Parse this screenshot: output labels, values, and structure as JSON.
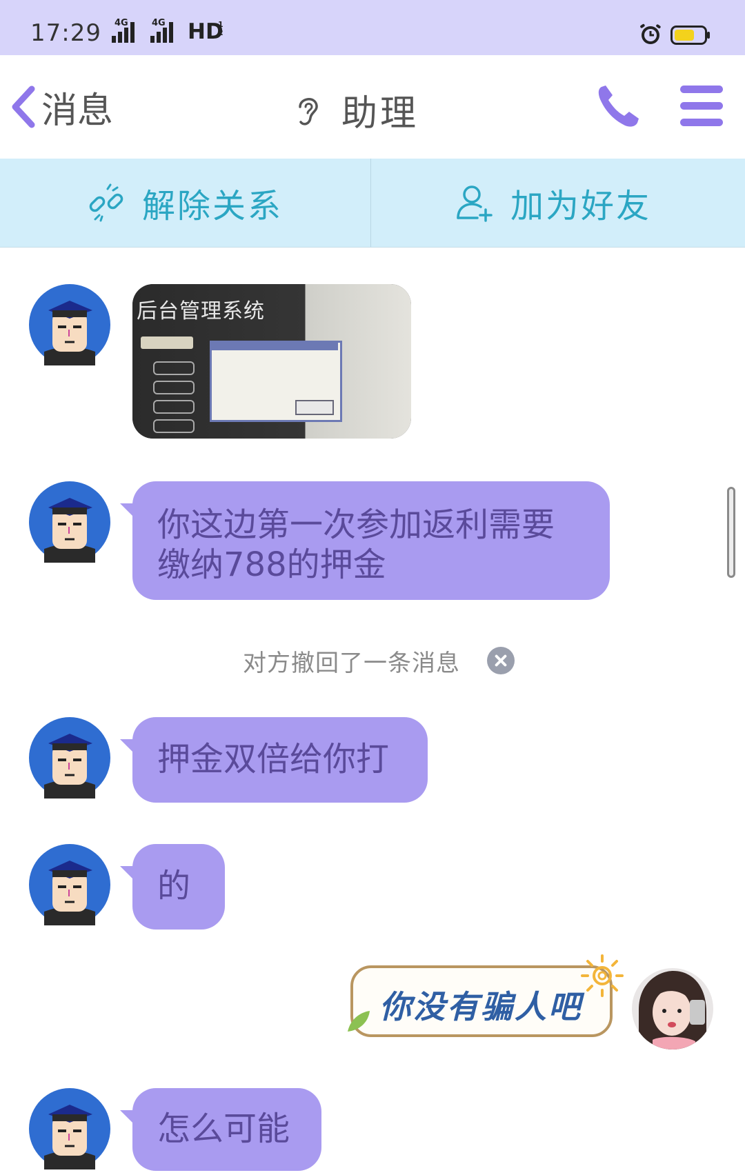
{
  "status_bar": {
    "time": "17:29",
    "network_1": "4G",
    "network_2": "4G",
    "hd": "HD",
    "hd_sub": "1 2"
  },
  "header": {
    "back_label": "消息",
    "title": "助理"
  },
  "action_bar": {
    "unlink_label": "解除关系",
    "add_friend_label": "加为好友"
  },
  "messages": {
    "image_caption": "后台管理系统",
    "msg_1": "你这边第一次参加返利需要缴纳788的押金",
    "recall_notice": "对方撤回了一条消息",
    "msg_2": "押金双倍给你打",
    "msg_3": "的",
    "sticker_text": "你没有骗人吧",
    "msg_4": "怎么可能"
  },
  "colors": {
    "accent_purple": "#8f77ea",
    "bubble_purple": "#a99bf0",
    "action_bar_bg": "#d2eefa",
    "action_text": "#2ba6c3",
    "status_bar_bg": "#d7d4fa"
  }
}
